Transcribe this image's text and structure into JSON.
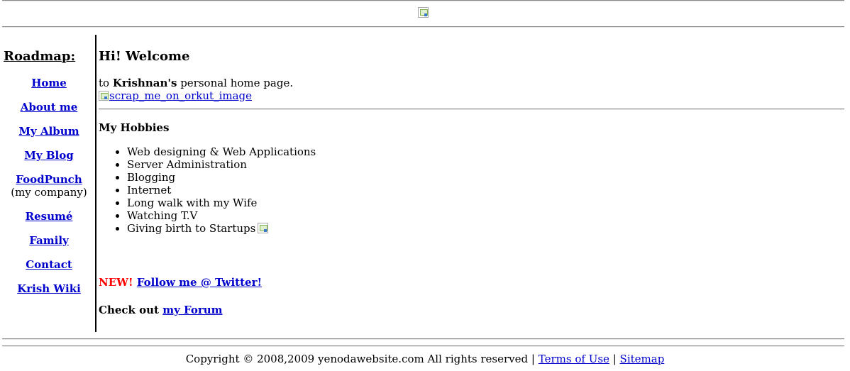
{
  "sidebar": {
    "title": "Roadmap:",
    "items": [
      {
        "label": "Home"
      },
      {
        "label": "About me"
      },
      {
        "label": "My Album"
      },
      {
        "label": "My Blog"
      },
      {
        "label": "FoodPunch",
        "sub": "(my company)"
      },
      {
        "label": "Resumé"
      },
      {
        "label": "Family"
      },
      {
        "label": "Contact"
      },
      {
        "label": "Krish Wiki"
      }
    ]
  },
  "main": {
    "welcome": "Hi! Welcome",
    "intro_prefix": "to",
    "intro_name": "Krishnan's",
    "intro_suffix": "personal home page.",
    "orkut_alt": "scrap_me_on_orkut_image",
    "hobbies_title": "My Hobbies",
    "hobbies": [
      "Web designing & Web Applications",
      "Server Administration",
      "Blogging",
      "Internet",
      "Long walk with my Wife",
      "Watching T.V",
      "Giving birth to Startups"
    ],
    "new_label": "NEW!",
    "twitter_link": "Follow me @ Twitter!",
    "forum_prefix": "Check out",
    "forum_link": "my Forum"
  },
  "footer": {
    "copyright": "Copyright © 2008,2009 yenodawebsite.com All rights reserved",
    "separator": "|",
    "terms": "Terms of Use",
    "sitemap": "Sitemap"
  },
  "colors": {
    "link": "#0000cc",
    "new": "#ff0000"
  },
  "icons": {
    "banner": "broken-image-icon",
    "startups": "broken-image-icon",
    "orkut": "broken-image-icon"
  }
}
